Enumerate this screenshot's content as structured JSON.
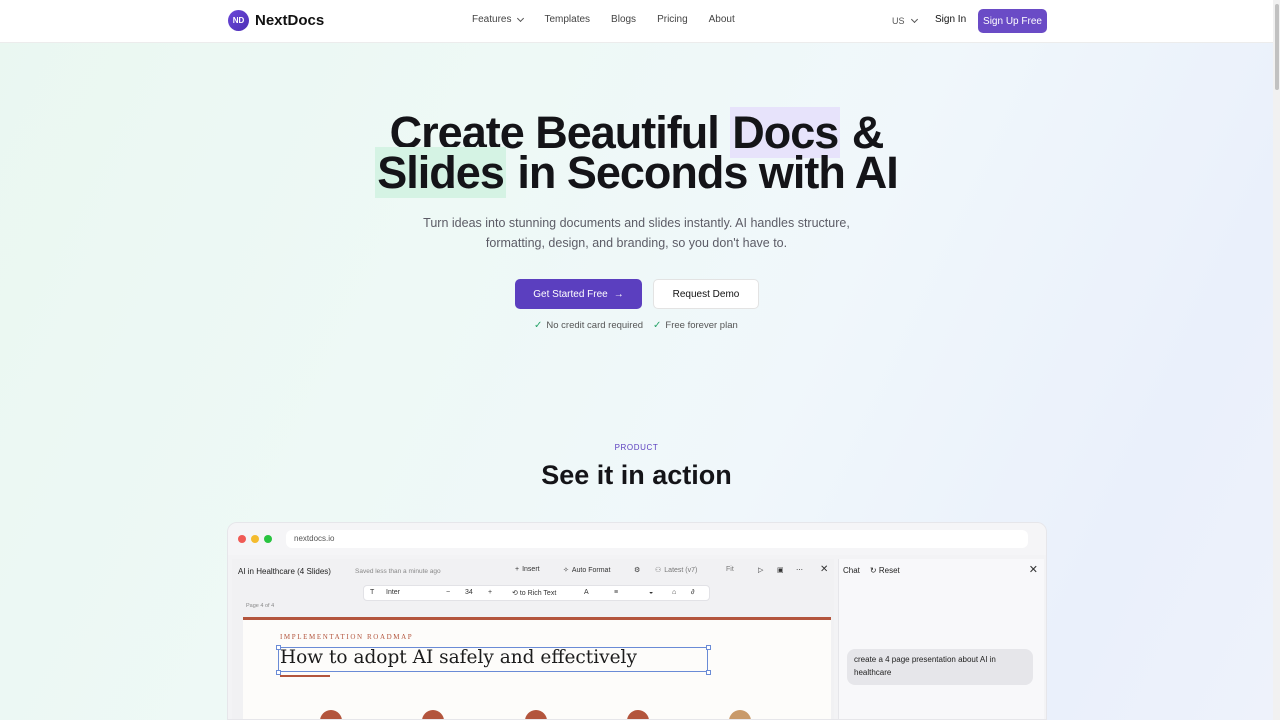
{
  "nav": {
    "brand": "NextDocs",
    "logo_mark": "ND",
    "links": [
      "Features",
      "Templates",
      "Blogs",
      "Pricing",
      "About"
    ],
    "lang": "US",
    "signin": "Sign In",
    "signup": "Sign Up Free"
  },
  "hero": {
    "title_1": "Create Beautiful ",
    "title_docs": "Docs",
    "title_2": " &",
    "title_slides": "Slides",
    "title_3": " in Seconds with AI",
    "subtitle": "Turn ideas into stunning documents and slides instantly. AI handles structure, formatting, design, and branding, so you don't have to.",
    "cta_primary": "Get Started Free",
    "cta_secondary": "Request Demo",
    "perks": [
      "No credit card required",
      "Free forever plan"
    ]
  },
  "product": {
    "eyebrow": "PRODUCT",
    "title": "See it in action"
  },
  "app": {
    "url": "nextdocs.io",
    "doc_title": "AI in Healthcare (4 Slides)",
    "saved": "Saved less than a minute ago",
    "insert": "Insert",
    "auto_format": "Auto Format",
    "latest": "Latest (v7)",
    "fit": "Fit",
    "font": "Inter",
    "font_size": "34",
    "convert": "to Rich Text",
    "page_label": "Page 4 of 4",
    "slide_eyebrow": "IMPLEMENTATION ROADMAP",
    "slide_title": "How to adopt AI safely and effectively",
    "chat_label": "Chat",
    "reset_label": "Reset",
    "chat_message": "create a 4 page presentation about AI in healthcare"
  },
  "colors": {
    "accent": "#5b3fbf",
    "accent_light": "#6a4bc6",
    "highlight_purple": "#e7e3fb",
    "highlight_green": "#d5f3e4",
    "slide_accent": "#b3553d",
    "check": "#2aa56b"
  },
  "icons": [
    "chevron-down-icon",
    "arrow-right-icon",
    "check-icon",
    "close-icon",
    "reset-icon",
    "plus-icon",
    "play-icon"
  ]
}
